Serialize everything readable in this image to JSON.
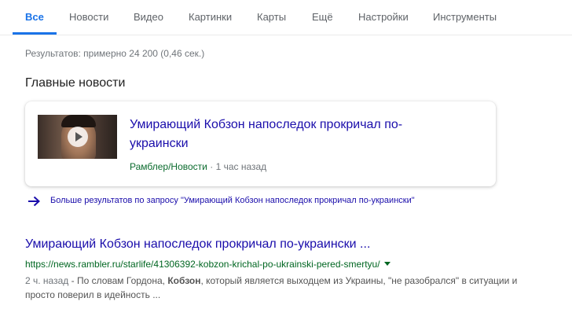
{
  "tabs": {
    "items": [
      {
        "label": "Все",
        "active": true
      },
      {
        "label": "Новости",
        "active": false
      },
      {
        "label": "Видео",
        "active": false
      },
      {
        "label": "Картинки",
        "active": false
      },
      {
        "label": "Карты",
        "active": false
      },
      {
        "label": "Ещё",
        "active": false
      },
      {
        "label": "Настройки",
        "active": false
      },
      {
        "label": "Инструменты",
        "active": false
      }
    ]
  },
  "stats": "Результатов: примерно 24 200 (0,46 сек.)",
  "top_stories": {
    "heading": "Главные новости",
    "card": {
      "title": "Умирающий Кобзон напоследок прокричал по-украински",
      "source": "Рамблер/Новости",
      "separator": "·",
      "time": "1 час назад",
      "thumbnail_icon": "play-icon"
    },
    "more_link": "Больше результатов по запросу \"Умирающий Кобзон напоследок прокричал по-украински\""
  },
  "result": {
    "title": "Умирающий Кобзон напоследок прокричал по-украински ...",
    "url": "https://news.rambler.ru/starlife/41306392-kobzon-krichal-po-ukrainski-pered-smertyu/",
    "snippet": {
      "date": "2 ч. назад",
      "dash": " - ",
      "part1": "По словам Гордона, ",
      "bold": "Кобзон",
      "part2": ", который является выходцем из Украины, \"не разобрался\" в ситуации и просто поверил в идейность ..."
    }
  },
  "colors": {
    "accent": "#1a73e8",
    "link": "#1a0dab",
    "url_green": "#006621",
    "source_green": "#0b6b2e"
  }
}
